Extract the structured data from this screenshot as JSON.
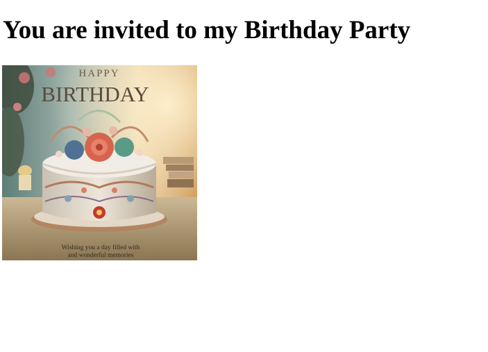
{
  "page": {
    "heading": "You are invited to my Birthday Party"
  },
  "card": {
    "happy": "HAPPY",
    "birthday": "BIRTHDAY",
    "message_line1": "Wishing you a day filled with",
    "message_line2": "and wonderful memories"
  },
  "colors": {
    "background": "#ffffff",
    "text": "#000000",
    "card_warm": "#e9c48a",
    "card_cool": "#8aa3a0",
    "frosting": "#eae6df",
    "rose": "#d7644c"
  }
}
